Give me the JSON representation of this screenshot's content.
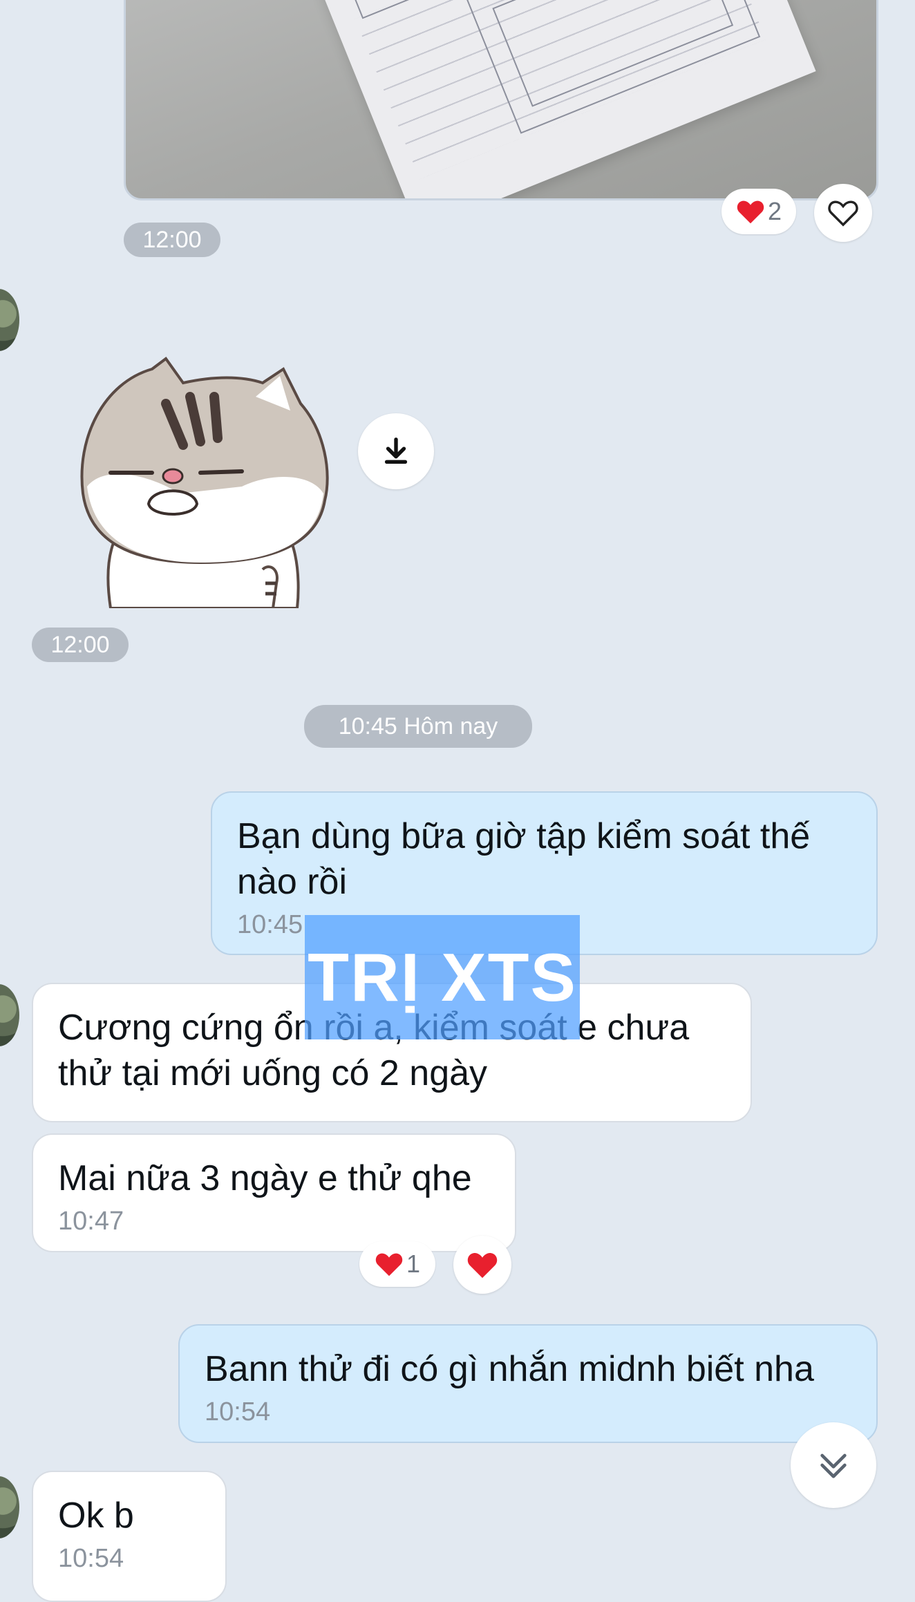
{
  "photo_message": {
    "time": "12:00",
    "reaction": {
      "emoji": "❤️",
      "count": "2"
    }
  },
  "sticker_message": {
    "time": "12:00",
    "sticker_name": "cat-sticker"
  },
  "date_divider": "10:45 Hôm nay",
  "messages": [
    {
      "direction": "out",
      "text": "Bạn dùng bữa giờ tập kiểm soát thế nào rồi",
      "time": "10:45"
    },
    {
      "direction": "in",
      "text": "Cương cứng ổn rồi a, kiểm soát e chưa thử tại mới uống có 2 ngày",
      "time": ""
    },
    {
      "direction": "in",
      "text": "Mai nữa 3 ngày e thử qhe",
      "time": "10:47",
      "reaction": {
        "emoji": "❤️",
        "count": "1"
      }
    },
    {
      "direction": "out",
      "text": "Bann thử đi có gì nhắn midnh biết nha",
      "time": "10:54"
    },
    {
      "direction": "in",
      "text": "Ok b",
      "time": "10:54"
    }
  ],
  "watermark": "TRỊ XTS",
  "colors": {
    "background": "#e2e9f1",
    "outgoing_bubble": "#d4ecfd",
    "incoming_bubble": "#ffffff",
    "heart": "#e8202e",
    "watermark": "#50a0ff"
  }
}
